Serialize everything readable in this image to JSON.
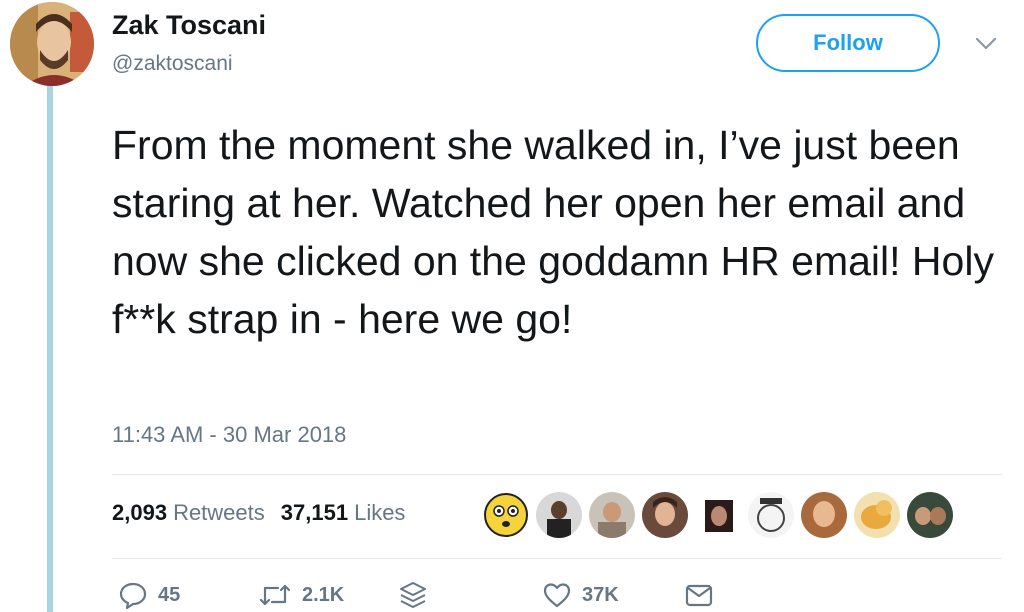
{
  "author": {
    "name": "Zak Toscani",
    "handle": "@zaktoscani"
  },
  "follow_label": "Follow",
  "tweet": {
    "text": "From the moment she walked in, I’ve just been staring at her. Watched her open her email and now she clicked on the goddamn HR email! Holy f**k strap in - here we go!",
    "timestamp": "11:43 AM - 30 Mar 2018"
  },
  "stats": {
    "retweets_count": "2,093",
    "retweets_label": "Retweets",
    "likes_count": "37,151",
    "likes_label": "Likes"
  },
  "actions": {
    "replies": "45",
    "retweets": "2.1K",
    "likes": "37K"
  },
  "icons": {
    "reply": "speech-bubble-icon",
    "retweet": "retweet-arrows-icon",
    "stack": "layers-icon",
    "like": "heart-icon",
    "message": "envelope-icon",
    "menu": "chevron-down-icon"
  },
  "colors": {
    "accent": "#1da1f2",
    "secondary_text": "#657786",
    "thread_line": "#a9d4e4"
  }
}
